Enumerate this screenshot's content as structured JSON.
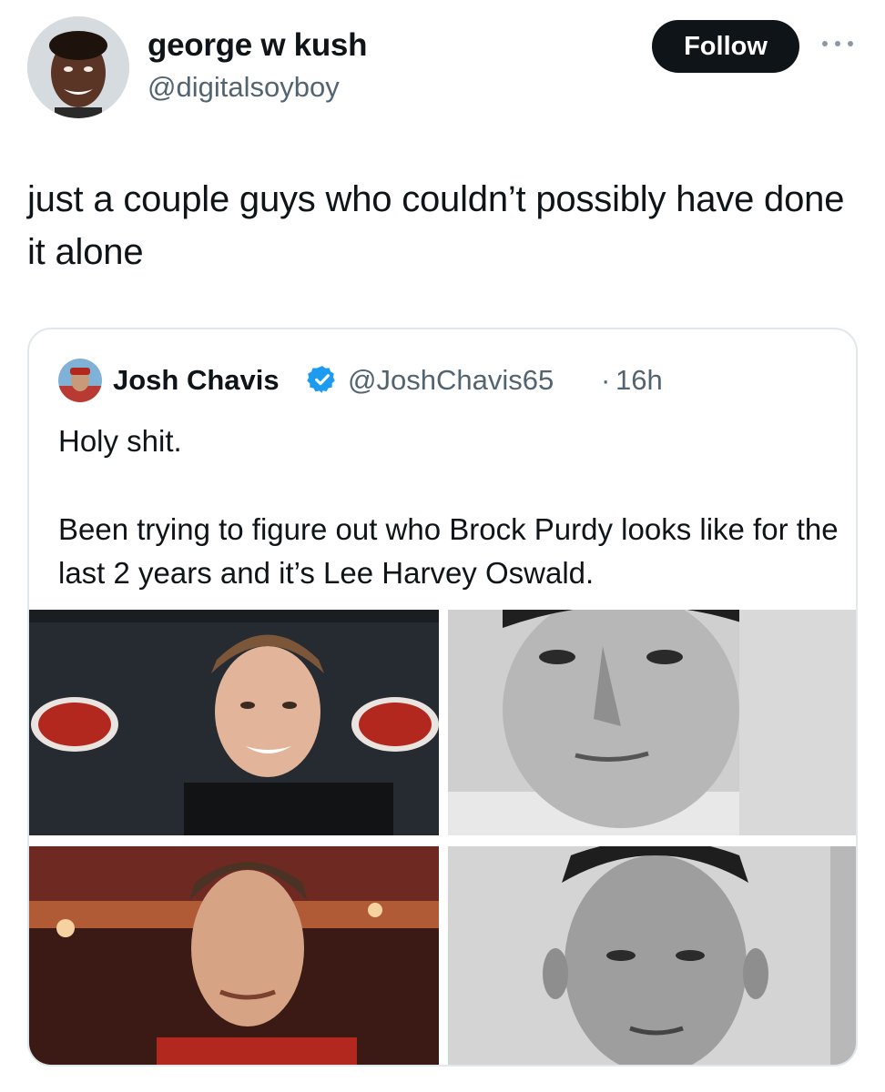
{
  "tweet": {
    "author": {
      "display_name": "george w kush",
      "handle": "@digitalsoyboy"
    },
    "follow_label": "Follow",
    "more_icon": "more-horizontal-icon",
    "text": "just a couple guys who couldn’t possibly have done it alone"
  },
  "quote": {
    "author": {
      "display_name": "Josh Chavis",
      "handle": "@JoshChavis65",
      "separator": "·",
      "time": "16h",
      "verified_icon": "verified-badge-icon"
    },
    "text_line1": "Holy shit.",
    "text_line2": "Been trying to figure out who Brock Purdy looks like for the last 2 years and it’s Lee Harvey Oswald."
  },
  "colors": {
    "text": "#0f1419",
    "muted": "#536471",
    "follow_bg": "#0f1419",
    "verified": "#1d9bf0",
    "border": "#e1e8ed"
  }
}
